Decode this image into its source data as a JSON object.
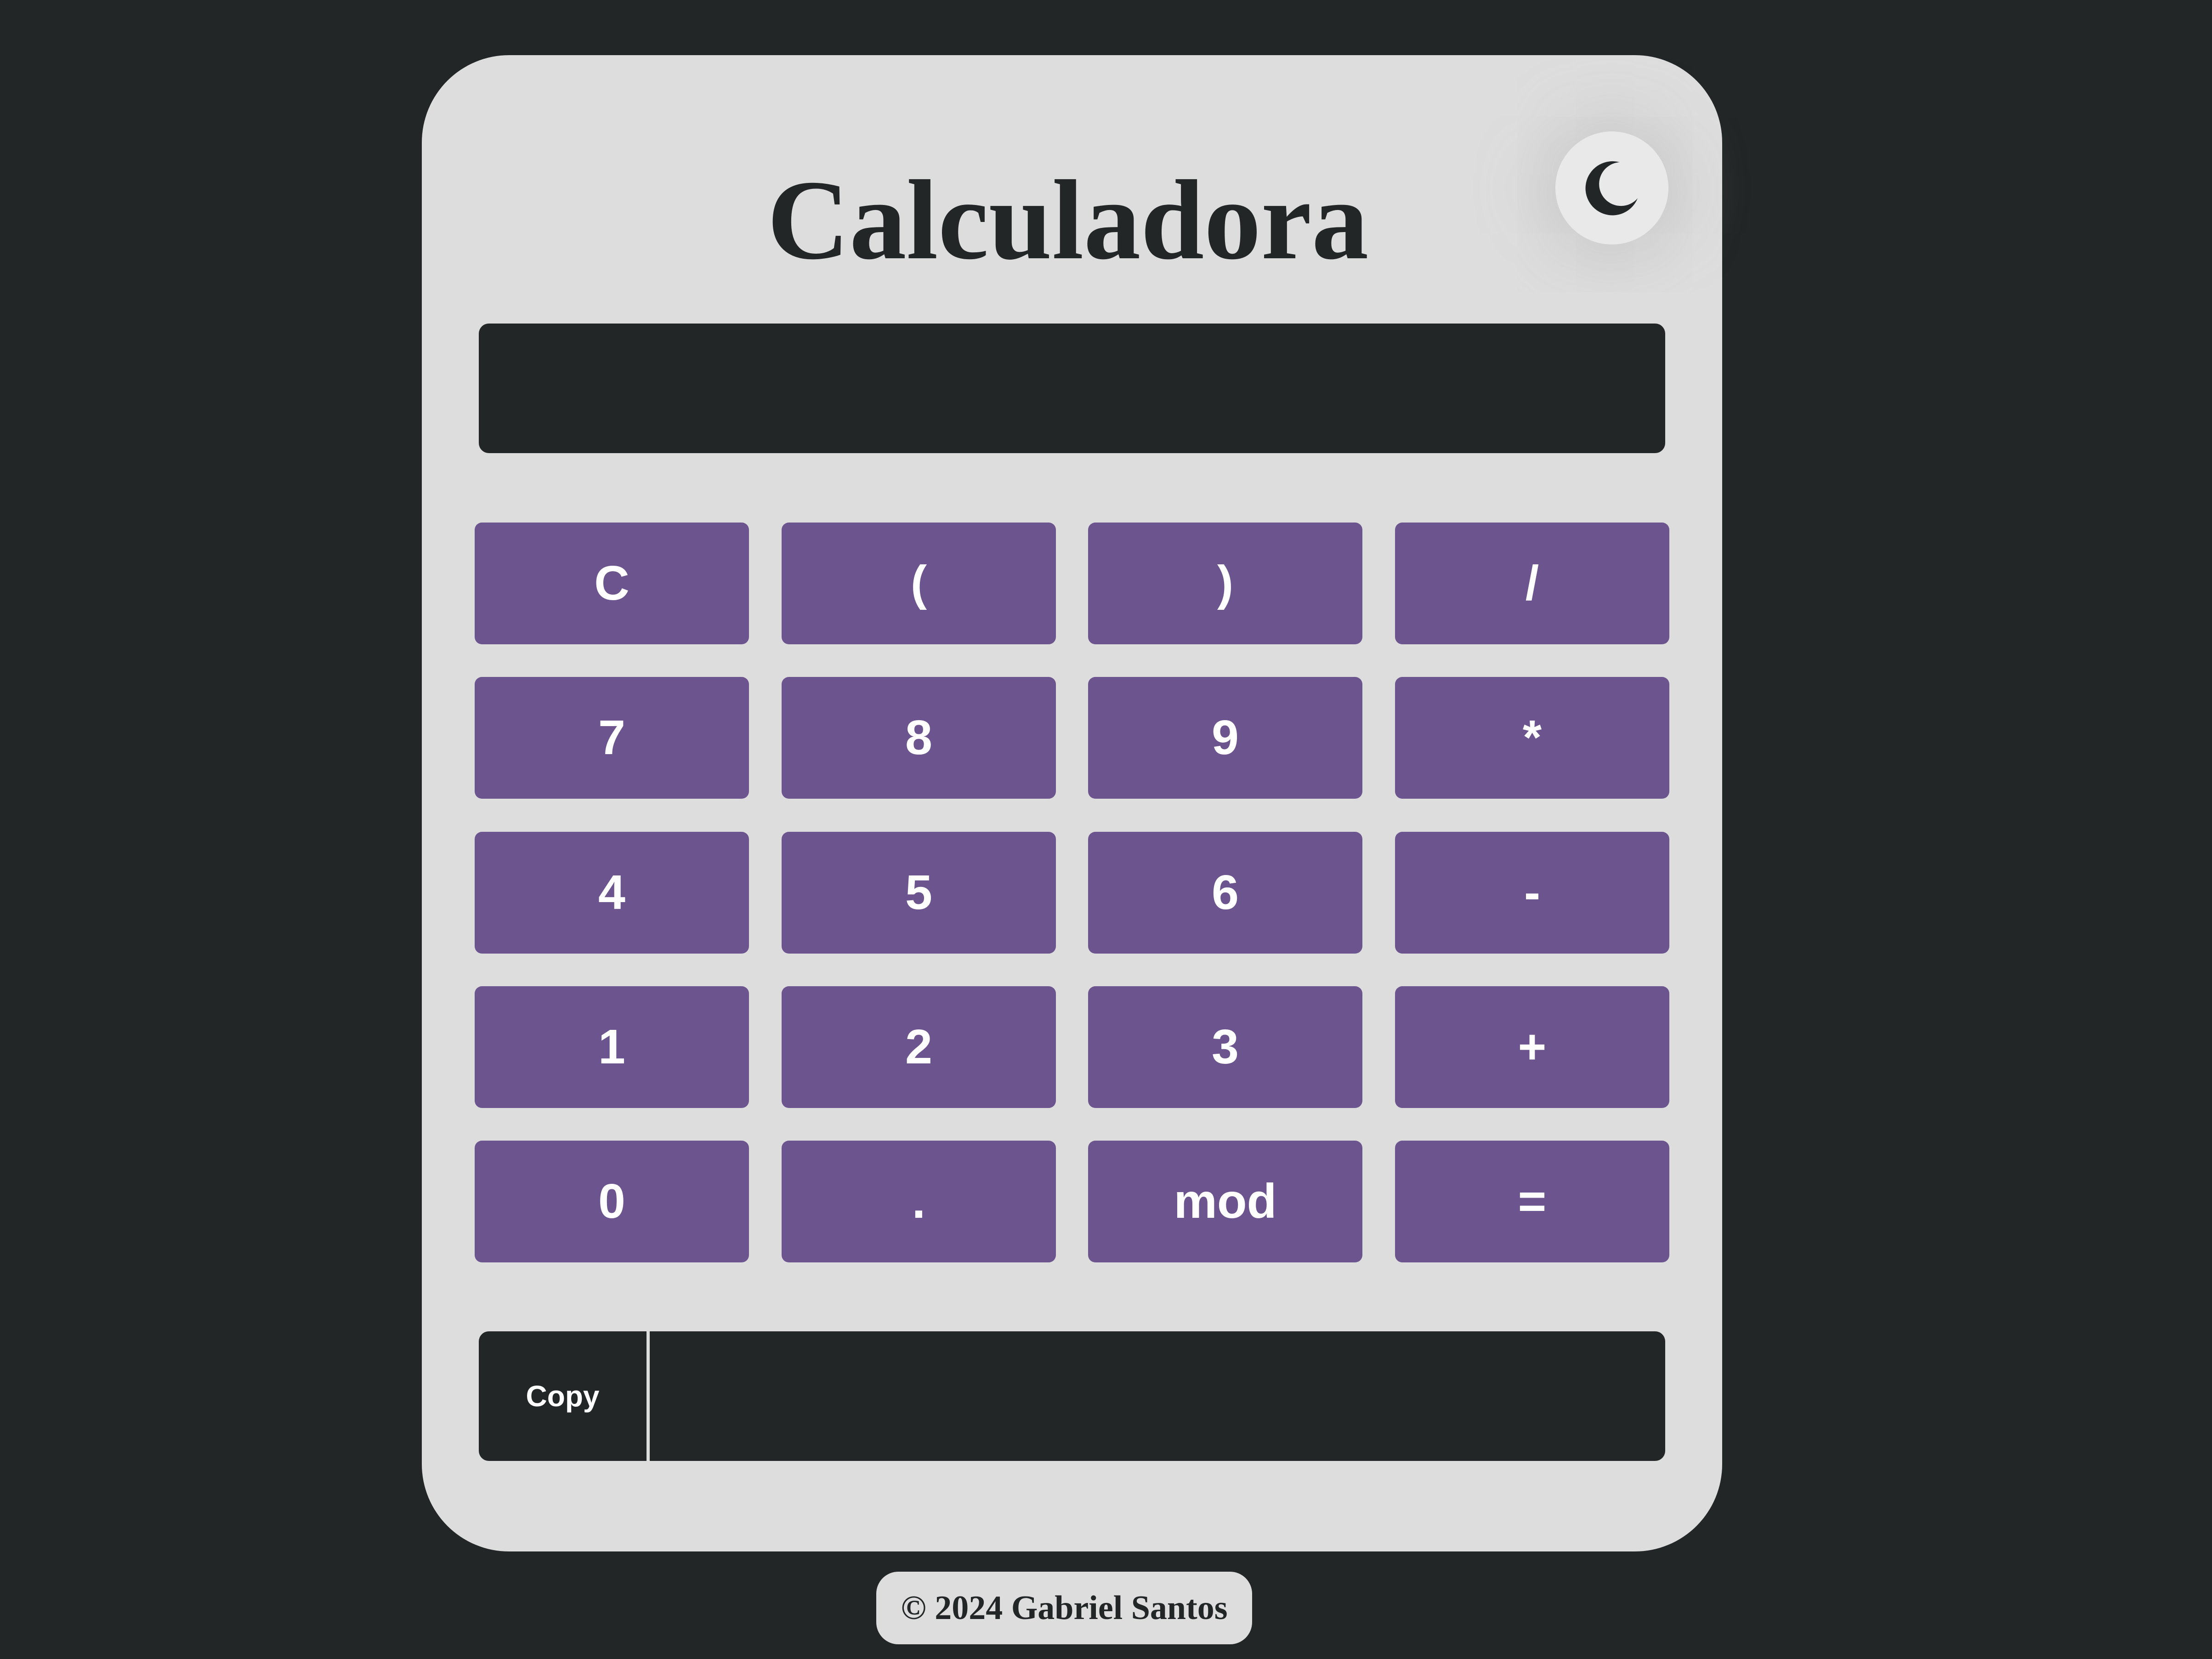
{
  "app": {
    "title": "Calculadora"
  },
  "theme_toggle": {
    "icon": "moon-icon"
  },
  "display": {
    "value": ""
  },
  "keypad": {
    "rows": [
      [
        "C",
        "(",
        ")",
        "/"
      ],
      [
        "7",
        "8",
        "9",
        "*"
      ],
      [
        "4",
        "5",
        "6",
        "-"
      ],
      [
        "1",
        "2",
        "3",
        "+"
      ],
      [
        "0",
        ".",
        "mod",
        "="
      ]
    ]
  },
  "result": {
    "copy_label": "Copy",
    "value": ""
  },
  "footer": {
    "text": "© 2024 Gabriel Santos"
  },
  "colors": {
    "page_background": "#232627",
    "card_background": "#dddddd",
    "key_background": "#6c548e",
    "key_text": "#ffffff",
    "display_background": "#232627"
  }
}
